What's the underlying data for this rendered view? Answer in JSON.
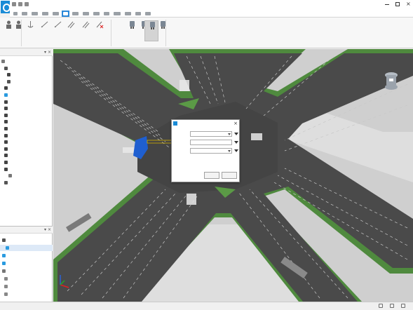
{
  "app": {
    "title": "",
    "colors": {
      "accent": "#2b88d8",
      "brand": "#1a8bd6",
      "road": "#4a4a4a",
      "median": "#5b9a46"
    }
  },
  "title_bar": {
    "logo_icon": "app-logo-icon",
    "quick_access_icons": [
      "save-icon",
      "undo-icon",
      "redo-icon"
    ],
    "window_controls": [
      "minimize-icon",
      "maximize-icon",
      "close-icon"
    ]
  },
  "menu": {
    "tabs": [
      {
        "label": ""
      },
      {
        "label": ""
      },
      {
        "label": ""
      },
      {
        "label": ""
      },
      {
        "label": ""
      },
      {
        "label": "",
        "active": true
      },
      {
        "label": ""
      },
      {
        "label": ""
      },
      {
        "label": ""
      },
      {
        "label": ""
      },
      {
        "label": ""
      },
      {
        "label": ""
      },
      {
        "label": ""
      },
      {
        "label": ""
      }
    ]
  },
  "ribbon": {
    "buttons": [
      {
        "label": "",
        "icon": "person-icon"
      },
      {
        "label": "",
        "icon": "person-icon"
      },
      {
        "label": "",
        "icon": "anchor-icon"
      },
      {
        "label": "",
        "icon": "line-icon"
      },
      {
        "label": "",
        "icon": "line-icon"
      },
      {
        "label": "",
        "icon": "lines-icon"
      },
      {
        "label": "",
        "icon": "lines-icon"
      },
      {
        "label": "",
        "icon": "delete-lines-icon"
      },
      {
        "label": "",
        "icon": "vehicle-icon"
      },
      {
        "label": "",
        "icon": "vehicle-icon"
      },
      {
        "label": "",
        "icon": "vehicle-icon",
        "selected": true
      },
      {
        "label": "",
        "icon": "vehicle-icon"
      }
    ],
    "groups": [
      {
        "label": ""
      },
      {
        "label": ""
      },
      {
        "label": ""
      }
    ]
  },
  "scene_panel": {
    "title": "",
    "controls": "▾ ×",
    "items": [
      {
        "label": "",
        "icon": "folder-icon"
      },
      {
        "label": "",
        "icon": "folder-icon"
      },
      {
        "label": "",
        "icon": "road-icon"
      },
      {
        "label": "",
        "icon": "road-icon"
      },
      {
        "label": "",
        "icon": "road-icon"
      },
      {
        "label": "",
        "icon": "road-icon"
      },
      {
        "label": "",
        "icon": "road-icon"
      },
      {
        "label": "",
        "icon": "road-icon"
      },
      {
        "label": "",
        "icon": "road-icon"
      },
      {
        "label": "",
        "icon": "road-icon"
      },
      {
        "label": "",
        "icon": "road-icon"
      },
      {
        "label": "",
        "icon": "road-icon"
      },
      {
        "label": "",
        "icon": "road-icon"
      },
      {
        "label": "",
        "icon": "road-icon"
      },
      {
        "label": "",
        "icon": "road-icon"
      },
      {
        "label": "",
        "icon": "road-icon"
      },
      {
        "label": "",
        "icon": "road-icon"
      },
      {
        "label": "",
        "icon": "road-icon"
      },
      {
        "label": "",
        "icon": "road-icon"
      }
    ],
    "tabs": [
      {
        "label": ""
      },
      {
        "label": ""
      },
      {
        "label": ""
      }
    ]
  },
  "props_panel": {
    "title": "",
    "controls": "▾ ×",
    "items": [
      {
        "label": "",
        "icon": "folder-icon"
      },
      {
        "label": "",
        "icon": "layer-icon"
      },
      {
        "label": "",
        "icon": "layer-icon"
      },
      {
        "label": "",
        "icon": "layer-icon"
      },
      {
        "label": "",
        "icon": "layer-icon"
      },
      {
        "label": "",
        "icon": "layer-icon"
      },
      {
        "label": "",
        "icon": "layer-icon"
      },
      {
        "label": "",
        "icon": "layer-icon"
      }
    ]
  },
  "dialog": {
    "title": "",
    "close": "×",
    "fields": [
      {
        "label": "",
        "value": ""
      },
      {
        "label": "",
        "value": ""
      },
      {
        "label": "",
        "value": ""
      }
    ],
    "ok_label": "",
    "cancel_label": ""
  },
  "status_bar": {
    "text": "",
    "watermark": "",
    "icons": [
      "grid-icon",
      "snap-icon",
      "zoom-icon"
    ]
  },
  "viewport": {
    "nav_cube_icon": "navigation-cube-icon",
    "axis_icon": "xyz-axis-icon"
  }
}
